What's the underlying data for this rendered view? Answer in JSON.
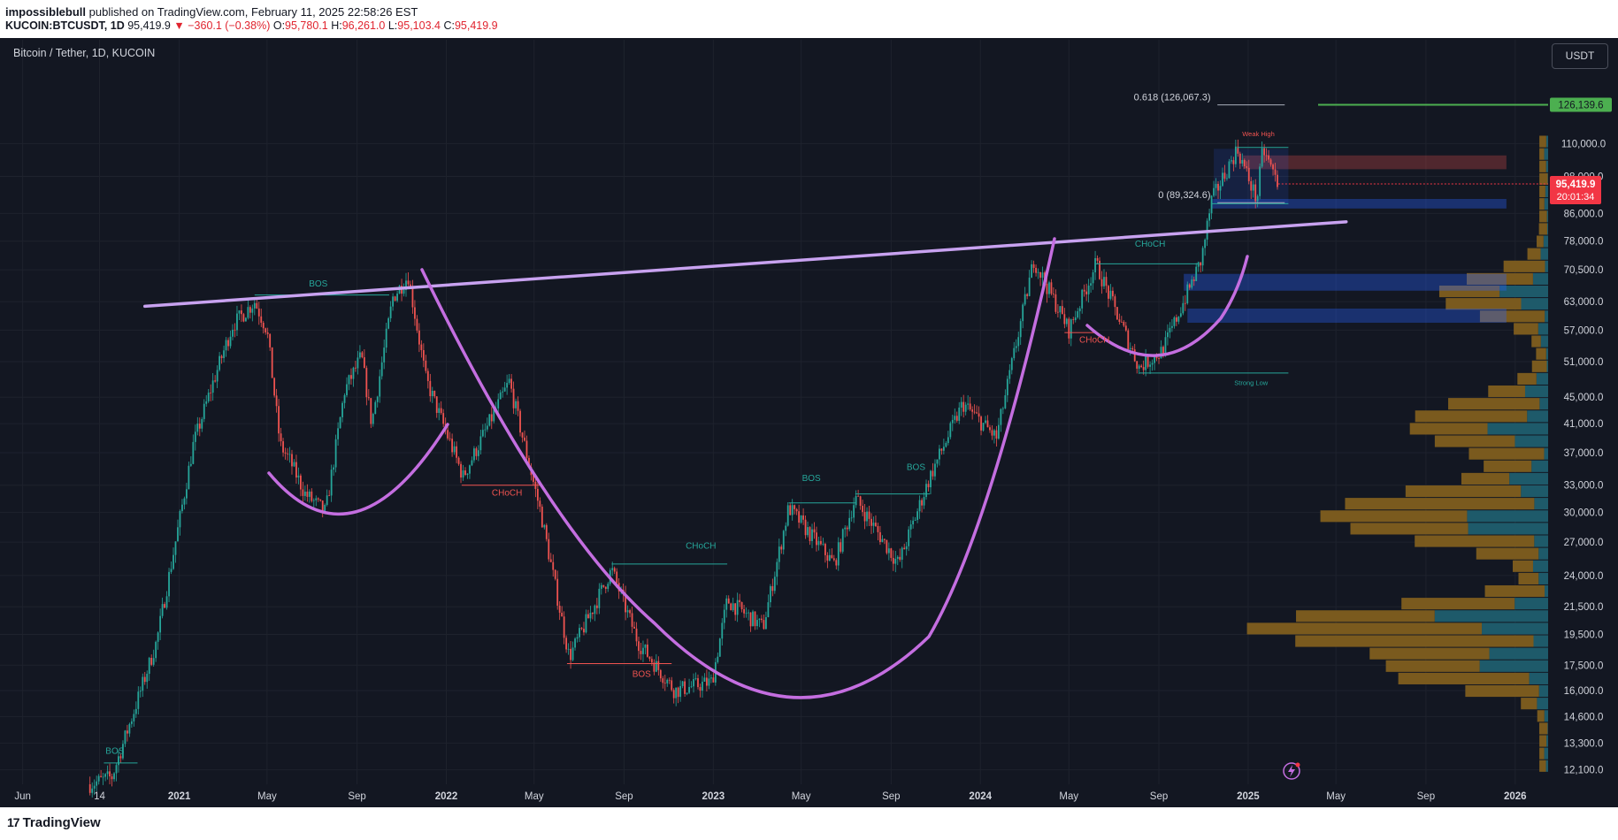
{
  "header": {
    "author": "impossiblebull",
    "published": "published on TradingView.com, February 11, 2025 22:58:26 EST",
    "symbol": "KUCOIN:BTCUSDT, 1D",
    "last": "95,419.9",
    "change": "−360.1 (−0.38%)",
    "o_label": "O:",
    "o_value": "95,780.1",
    "h_label": "H:",
    "h_value": "96,261.0",
    "l_label": "L:",
    "l_value": "95,103.4",
    "c_label": "C:",
    "c_value": "95,419.9"
  },
  "chart_title": "Bitcoin / Tether, 1D, KUCOIN",
  "currency": "USDT",
  "footer": {
    "brand": "TradingView",
    "brand_mark": "17"
  },
  "colors": {
    "background": "#131722",
    "bull": "#26a69a",
    "bear": "#ef5350",
    "trendline": "#c8a2f0",
    "curve": "#c46ee0",
    "price_badge": "#f23645",
    "target_badge": "#4caf50",
    "volume_up": "#1e5a6a",
    "volume_down": "#7a5a1e"
  },
  "chart_data": {
    "type": "candlestick",
    "title": "Bitcoin / Tether, 1D, KUCOIN",
    "y_scale": "log",
    "ylim": [
      11500,
      140000
    ],
    "xlim": [
      "2020-05-01",
      "2026-02-15"
    ],
    "y_ticks": [
      110000,
      98000,
      86000,
      78000,
      70500,
      63000,
      57000,
      51000,
      45000,
      41000,
      37000,
      33000,
      30000,
      27000,
      24000,
      21500,
      19500,
      17500,
      16000,
      14600,
      13300,
      12100
    ],
    "y_tick_labels": [
      "110,000.0",
      "98,000.0",
      "86,000.0",
      "78,000.0",
      "70,500.0",
      "63,000.0",
      "57,000.0",
      "51,000.0",
      "45,000.0",
      "41,000.0",
      "37,000.0",
      "33,000.0",
      "30,000.0",
      "27,000.0",
      "24,000.0",
      "21,500.0",
      "19,500.0",
      "17,500.0",
      "16,000.0",
      "14,600.0",
      "13,300.0",
      "12,100.0"
    ],
    "x_ticks": [
      {
        "label": "Jun",
        "date": "2020-06-01"
      },
      {
        "label": "14",
        "date": "2020-09-14"
      },
      {
        "label": "2021",
        "date": "2021-01-01"
      },
      {
        "label": "May",
        "date": "2021-05-01"
      },
      {
        "label": "Sep",
        "date": "2021-09-01"
      },
      {
        "label": "2022",
        "date": "2022-01-01"
      },
      {
        "label": "May",
        "date": "2022-05-01"
      },
      {
        "label": "Sep",
        "date": "2022-09-01"
      },
      {
        "label": "2023",
        "date": "2023-01-01"
      },
      {
        "label": "May",
        "date": "2023-05-01"
      },
      {
        "label": "Sep",
        "date": "2023-09-01"
      },
      {
        "label": "2024",
        "date": "2024-01-01"
      },
      {
        "label": "May",
        "date": "2024-05-01"
      },
      {
        "label": "Sep",
        "date": "2024-09-01"
      },
      {
        "label": "2025",
        "date": "2025-01-01"
      },
      {
        "label": "May",
        "date": "2025-05-01"
      },
      {
        "label": "Sep",
        "date": "2025-09-01"
      },
      {
        "label": "2026",
        "date": "2026-01-01"
      }
    ],
    "price_path": [
      [
        "2020-09-01",
        11500
      ],
      [
        "2020-10-01",
        11800
      ],
      [
        "2020-11-01",
        15000
      ],
      [
        "2020-12-01",
        19000
      ],
      [
        "2021-01-01",
        29000
      ],
      [
        "2021-01-20",
        38000
      ],
      [
        "2021-02-15",
        47000
      ],
      [
        "2021-03-15",
        58000
      ],
      [
        "2021-04-14",
        63000
      ],
      [
        "2021-05-01",
        57000
      ],
      [
        "2021-05-19",
        38000
      ],
      [
        "2021-06-01",
        36000
      ],
      [
        "2021-06-22",
        32000
      ],
      [
        "2021-07-20",
        30000
      ],
      [
        "2021-08-15",
        46000
      ],
      [
        "2021-09-07",
        52000
      ],
      [
        "2021-09-21",
        41000
      ],
      [
        "2021-10-20",
        64000
      ],
      [
        "2021-11-10",
        69000
      ],
      [
        "2021-12-04",
        48000
      ],
      [
        "2022-01-24",
        34000
      ],
      [
        "2022-03-28",
        47500
      ],
      [
        "2022-05-10",
        30000
      ],
      [
        "2022-06-18",
        18000
      ],
      [
        "2022-08-15",
        24500
      ],
      [
        "2022-09-20",
        19000
      ],
      [
        "2022-11-09",
        16000
      ],
      [
        "2022-12-30",
        16500
      ],
      [
        "2023-01-20",
        22000
      ],
      [
        "2023-03-10",
        20000
      ],
      [
        "2023-04-14",
        30500
      ],
      [
        "2023-06-15",
        25000
      ],
      [
        "2023-07-14",
        31500
      ],
      [
        "2023-09-11",
        25000
      ],
      [
        "2023-10-24",
        34000
      ],
      [
        "2023-12-08",
        44000
      ],
      [
        "2024-01-23",
        39000
      ],
      [
        "2024-03-14",
        73000
      ],
      [
        "2024-05-01",
        57000
      ],
      [
        "2024-06-07",
        72000
      ],
      [
        "2024-08-05",
        50000
      ],
      [
        "2024-09-06",
        53000
      ],
      [
        "2024-10-29",
        73000
      ],
      [
        "2024-11-12",
        90000
      ],
      [
        "2024-12-17",
        108000
      ],
      [
        "2025-01-13",
        90000
      ],
      [
        "2025-01-21",
        108000
      ],
      [
        "2025-02-11",
        95419.9
      ]
    ],
    "trendline": {
      "from": [
        "2020-11-15",
        62000
      ],
      "to": [
        "2025-05-15",
        83500
      ]
    },
    "fib_levels": [
      {
        "label": "0.618 (126,067.3)",
        "value": 126067.3
      },
      {
        "label": "0 (89,324.6)",
        "value": 89324.6
      }
    ],
    "last_price": {
      "value": 95419.9,
      "label": "95,419.9",
      "countdown": "20:01:34"
    },
    "target_badge": {
      "value": 126139.6,
      "label": "126,139.6"
    },
    "annotations": [
      {
        "text": "BOS",
        "date": "2020-10-05",
        "value": 12800,
        "kind": "bull"
      },
      {
        "text": "BOS",
        "date": "2021-07-10",
        "value": 66500,
        "kind": "bull"
      },
      {
        "text": "CHoCH",
        "date": "2022-03-25",
        "value": 31800,
        "kind": "bear"
      },
      {
        "text": "BOS",
        "date": "2022-09-25",
        "value": 16800,
        "kind": "bear"
      },
      {
        "text": "CHoCH",
        "date": "2022-12-15",
        "value": 26400,
        "kind": "bull"
      },
      {
        "text": "BOS",
        "date": "2023-05-15",
        "value": 33500,
        "kind": "bull"
      },
      {
        "text": "BOS",
        "date": "2023-10-05",
        "value": 34800,
        "kind": "bull"
      },
      {
        "text": "CHoCH",
        "date": "2024-06-05",
        "value": 54500,
        "kind": "bear"
      },
      {
        "text": "CHoCH",
        "date": "2024-08-20",
        "value": 76500,
        "kind": "bull"
      },
      {
        "text": "Weak High",
        "date": "2025-01-15",
        "value": 113000,
        "kind": "bear"
      },
      {
        "text": "Strong Low",
        "date": "2025-01-05",
        "value": 47000,
        "kind": "bull"
      }
    ]
  }
}
